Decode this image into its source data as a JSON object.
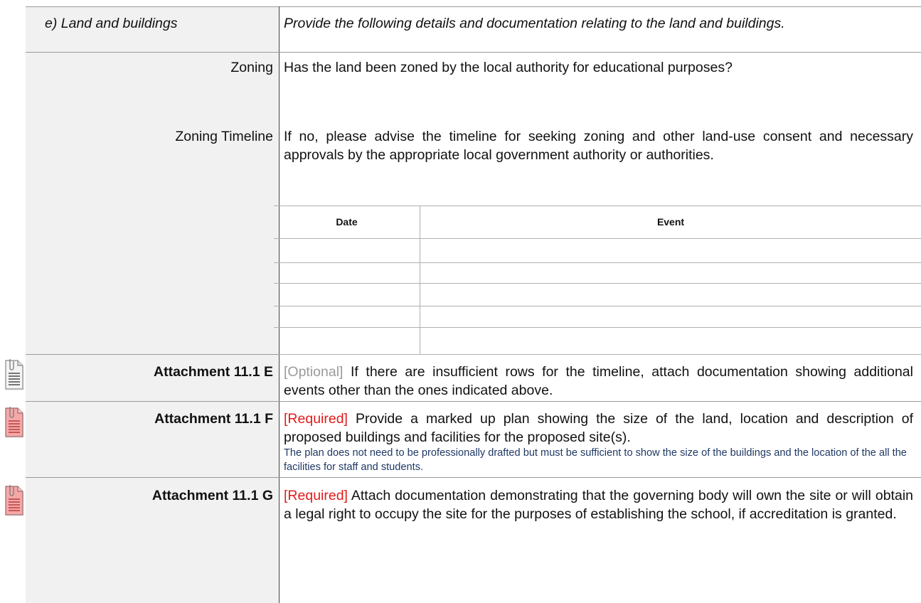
{
  "section": {
    "label": "e) Land and buildings",
    "intro": "Provide the following details and documentation relating to the land and buildings."
  },
  "zoning": {
    "label": "Zoning",
    "question": "Has the land been zoned by the local authority for educational purposes?"
  },
  "zoning_timeline": {
    "label": "Zoning Timeline",
    "instruction": "If no, please advise the timeline for seeking zoning and other land-use consent and necessary approvals by the appropriate local government authority or authorities.",
    "table": {
      "headers": [
        "Date",
        "Event"
      ],
      "rows": [
        {
          "date": "",
          "event": ""
        },
        {
          "date": "",
          "event": ""
        },
        {
          "date": "",
          "event": ""
        },
        {
          "date": "",
          "event": ""
        },
        {
          "date": "",
          "event": ""
        },
        {
          "date": "",
          "event": ""
        }
      ]
    }
  },
  "attachments": [
    {
      "label": "Attachment 11.1 E",
      "tag": "[Optional]",
      "text": " If there are insufficient rows for the timeline, attach documentation showing additional events other than the ones indicated above.",
      "icon": "document-icon-grey"
    },
    {
      "label": "Attachment 11.1 F",
      "tag": "[Required]",
      "text": " Provide a marked up plan showing the size of the land, location and description of proposed buildings and facilities for the proposed site(s).",
      "note": "The plan does not need to be professionally drafted but must be sufficient to show the size of the buildings and the location of the all the facilities for staff and students.",
      "icon": "document-icon-red"
    },
    {
      "label": "Attachment 11.1 G",
      "tag": "[Required]",
      "text": " Attach documentation demonstrating that the governing body will own the site or will obtain a legal right to occupy the site for the purposes of establishing the school, if accreditation is granted.",
      "icon": "document-icon-red"
    }
  ],
  "colors": {
    "optional": "#9a9a9a",
    "required": "#e31b1b",
    "note": "#1f3864",
    "label_column": "#f1f1f1"
  }
}
